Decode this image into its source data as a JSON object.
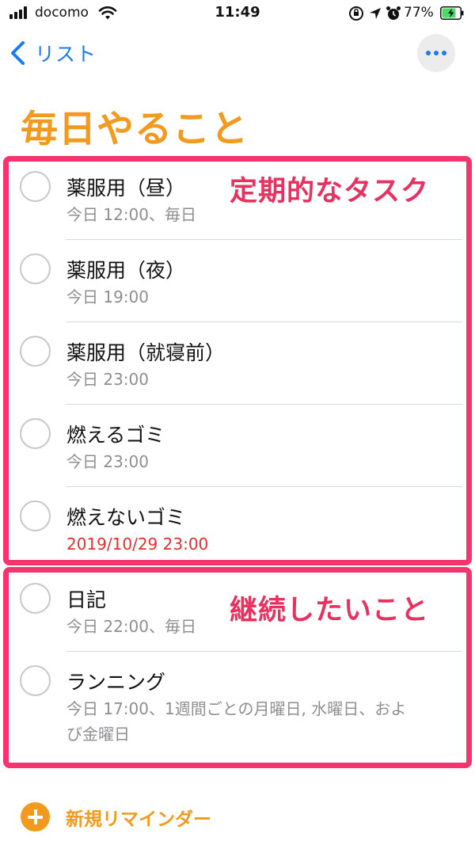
{
  "status_bar": {
    "carrier": "docomo",
    "time": "11:49",
    "battery_percent": "77%",
    "battery_level": 0.77,
    "icons": [
      "signal-icon",
      "wifi-icon",
      "orientation-lock-icon",
      "location-icon",
      "alarm-icon",
      "battery-icon"
    ]
  },
  "nav": {
    "back_label": "リスト",
    "more_icon": "ellipsis-icon"
  },
  "title": "毎日やること",
  "callouts": {
    "group1": "定期的なタスク",
    "group2": "継続したいこと"
  },
  "reminders": [
    {
      "title": "薬服用（昼）",
      "sub": [
        "今日 12:00、毎日"
      ],
      "overdue": false
    },
    {
      "title": "薬服用（夜）",
      "sub": [
        "今日 19:00"
      ],
      "overdue": false
    },
    {
      "title": "薬服用（就寝前）",
      "sub": [
        "今日 23:00"
      ],
      "overdue": false
    },
    {
      "title": "燃えるゴミ",
      "sub": [
        "今日 23:00"
      ],
      "overdue": false
    },
    {
      "title": "燃えないゴミ",
      "sub": [
        "2019/10/29 23:00"
      ],
      "overdue": true
    },
    {
      "title": "日記",
      "sub": [
        "今日 22:00、毎日"
      ],
      "overdue": false
    },
    {
      "title": "ランニング",
      "sub": [
        "今日 17:00、1週間ごとの月曜日, 水曜日、およ",
        "び金曜日"
      ],
      "overdue": false
    }
  ],
  "new_reminder_label": "新規リマインダー",
  "colors": {
    "accent_orange": "#f19a1e",
    "link_blue": "#1a7cf0",
    "highlight_pink": "#f5336c",
    "overdue_red": "#e62f2f",
    "secondary_gray": "#8e8e93"
  }
}
